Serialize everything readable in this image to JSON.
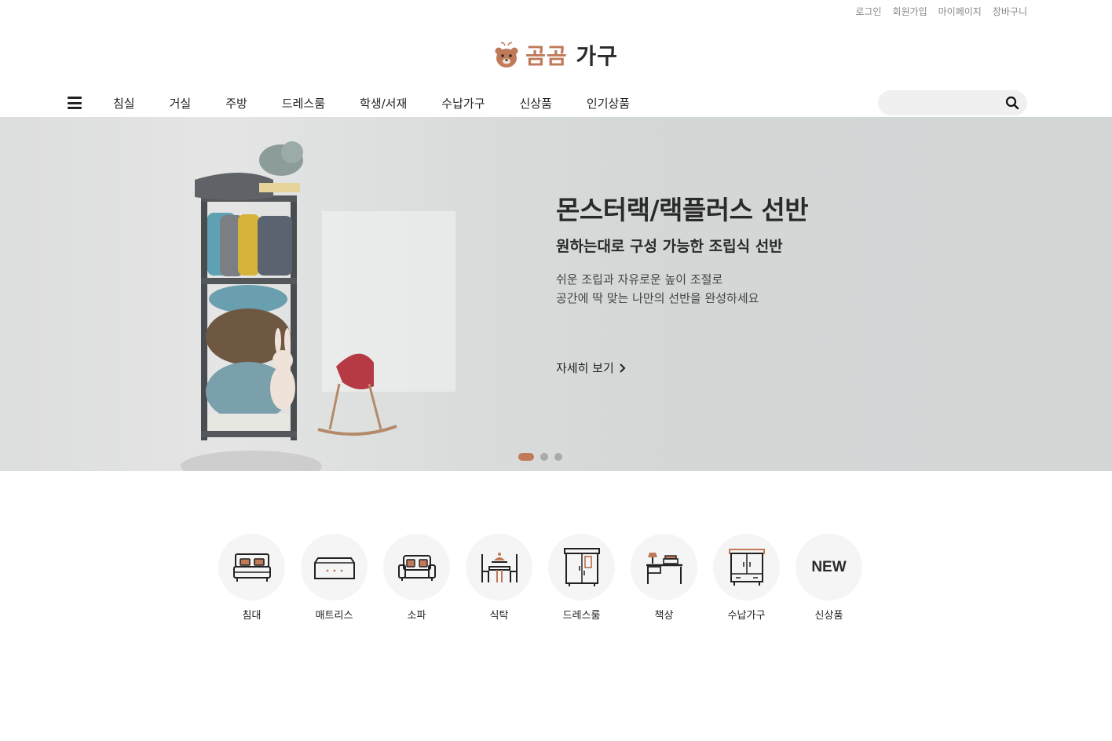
{
  "top_links": [
    "로그인",
    "회원가입",
    "마이페이지",
    "장바구니"
  ],
  "logo": {
    "brand": "곰곰",
    "rest": "가구"
  },
  "nav": {
    "items": [
      "침실",
      "거실",
      "주방",
      "드레스룸",
      "학생/서재",
      "수납가구",
      "신상품",
      "인기상품"
    ],
    "search_placeholder": ""
  },
  "banner": {
    "title": "몬스터랙/랙플러스 선반",
    "subtitle": "원하는대로 구성 가능한 조립식 선반",
    "desc_line1": "쉬운 조립과 자유로운 높이 조절로",
    "desc_line2": "공간에 딱 맞는 나만의 선반을 완성하세요",
    "more_label": "자세히 보기",
    "active_slide": 1,
    "slide_count": 3
  },
  "categories": [
    {
      "label": "침대",
      "icon": "bed-icon"
    },
    {
      "label": "매트리스",
      "icon": "mattress-icon"
    },
    {
      "label": "소파",
      "icon": "sofa-icon"
    },
    {
      "label": "식탁",
      "icon": "dining-table-icon"
    },
    {
      "label": "드레스룸",
      "icon": "wardrobe-icon"
    },
    {
      "label": "책상",
      "icon": "desk-icon"
    },
    {
      "label": "수납가구",
      "icon": "cabinet-icon"
    },
    {
      "label": "신상품",
      "icon": "new-icon",
      "icon_text": "NEW"
    }
  ],
  "colors": {
    "accent": "#c07a5a",
    "dark": "#2a2a2a",
    "banner_bg": "#d3d7d6"
  }
}
